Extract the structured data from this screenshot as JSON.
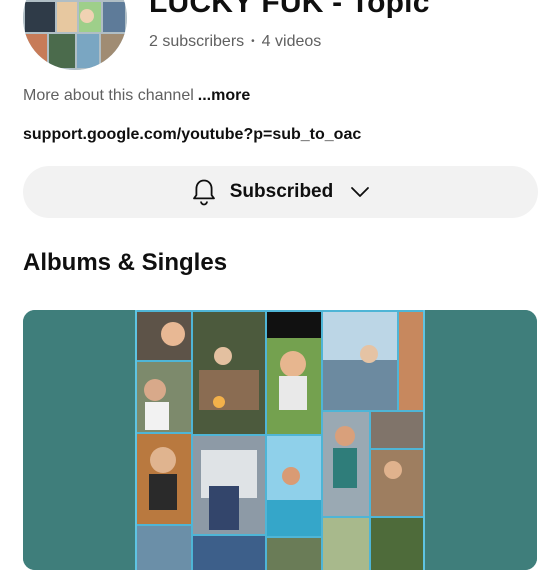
{
  "channel": {
    "title": "LUCKY FUK - Topic",
    "subscribers": "2 subscribers",
    "separator": "•",
    "videos": "4 videos",
    "about_text": "More about this channel",
    "about_more": "...more",
    "link": "support.google.com/youtube?p=sub_to_oac"
  },
  "subscribe": {
    "label": "Subscribed",
    "bell_icon": "notification-bell-icon",
    "chevron_icon": "chevron-down-icon"
  },
  "albums": {
    "section_title": "Albums & Singles"
  },
  "colors": {
    "card_background": "#3f7e7b",
    "button_background": "#f2f2f2",
    "secondary_text": "#606060"
  }
}
